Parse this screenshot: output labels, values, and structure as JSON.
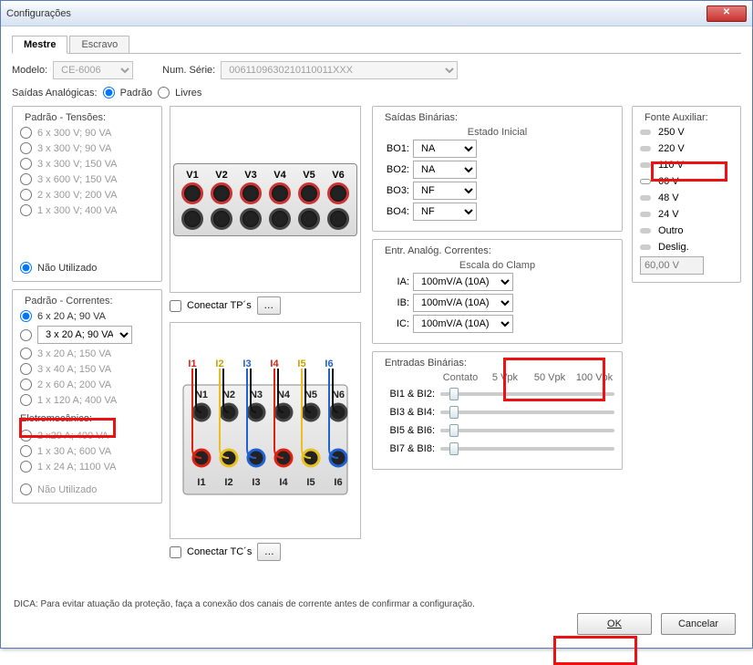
{
  "window": {
    "title": "Configurações"
  },
  "tabs": {
    "mestre": "Mestre",
    "escravo": "Escravo"
  },
  "model": {
    "label": "Modelo:",
    "value": "CE-6006"
  },
  "serial": {
    "label": "Num. Série:",
    "value": "0061109630210110011XXX"
  },
  "analog_out": {
    "label": "Saídas Analógicas:",
    "padrao": "Padrão",
    "livres": "Livres"
  },
  "tensoes": {
    "legend": "Padrão - Tensões:",
    "items": [
      "6 x 300 V; 90 VA",
      "3 x 300 V; 90 VA",
      "3 x 300 V; 150 VA",
      "3 x 600 V; 150 VA",
      "2 x 300 V; 200 VA",
      "1 x 300 V; 400 VA"
    ],
    "nao_utilizado": "Não Utilizado"
  },
  "correntes": {
    "legend": "Padrão - Correntes:",
    "sel": "6 x 20 A; 90 VA",
    "dd": "3 x 20 A; 90 VA",
    "items": [
      "3 x 20 A; 150 VA",
      "3 x 40 A; 150 VA",
      "2 x 60 A; 200 VA",
      "1 x 120 A; 400 VA"
    ],
    "eletro": "Eletromecânico:",
    "eitems": [
      "2 x20 A; 400 VA",
      "1 x 30 A; 600 VA",
      "1 x 24 A; 1100 VA"
    ],
    "nao_utilizado": "Não Utilizado"
  },
  "conectar_tp": "Conectar TP´s",
  "conectar_tc": "Conectar TC´s",
  "v_labels": [
    "V1",
    "V2",
    "V3",
    "V4",
    "V5",
    "V6"
  ],
  "i_top": [
    "I1",
    "I2",
    "I3",
    "I4",
    "I5",
    "I6"
  ],
  "n_labels": [
    "N1",
    "N2",
    "N3",
    "N4",
    "N5",
    "N6"
  ],
  "i_bottom": [
    "I1",
    "I2",
    "I3",
    "I4",
    "I5",
    "I6"
  ],
  "saidas_bin": {
    "title": "Saídas Binárias:",
    "sub": "Estado Inicial",
    "rows": [
      {
        "lbl": "BO1:",
        "val": "NA"
      },
      {
        "lbl": "BO2:",
        "val": "NA"
      },
      {
        "lbl": "BO3:",
        "val": "NF"
      },
      {
        "lbl": "BO4:",
        "val": "NF"
      }
    ]
  },
  "entr_analog": {
    "title": "Entr. Analóg. Correntes:",
    "sub": "Escala do Clamp",
    "rows": [
      {
        "lbl": "IA:",
        "val": "100mV/A (10A)"
      },
      {
        "lbl": "IB:",
        "val": "100mV/A (10A)"
      },
      {
        "lbl": "IC:",
        "val": "100mV/A (10A)"
      }
    ]
  },
  "entradas_bin": {
    "title": "Entradas Binárias:",
    "scale": [
      "Contato",
      "5 Vpk",
      "50 Vpk",
      "100 Vpk"
    ],
    "rows": [
      "BI1 & BI2:",
      "BI3 & BI4:",
      "BI5 & BI6:",
      "BI7 & BI8:"
    ]
  },
  "fonte": {
    "title": "Fonte Auxiliar:",
    "items": [
      "250 V",
      "220 V",
      "110 V",
      "60 V",
      "48 V",
      "24 V",
      "Outro",
      "Deslig."
    ],
    "field": "60,00 V"
  },
  "hint": "DICA: Para evitar atuação da proteção, faça a conexão dos canais de corrente antes de confirmar a configuração.",
  "buttons": {
    "ok": "OK",
    "cancel": "Cancelar"
  }
}
